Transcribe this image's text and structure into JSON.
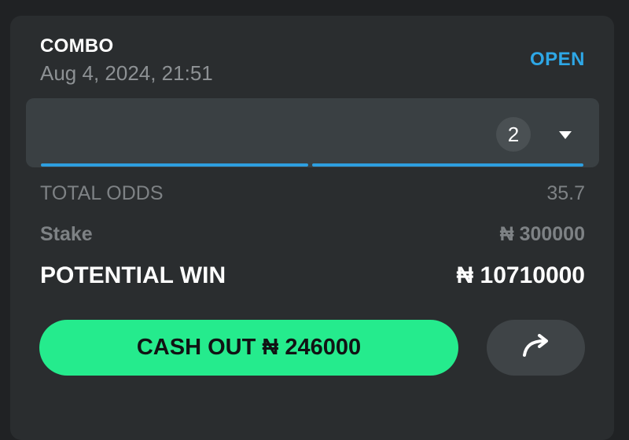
{
  "bet": {
    "type": "COMBO",
    "date": "Aug 4, 2024, 21:51",
    "status": "OPEN"
  },
  "selections": {
    "count": "2",
    "expand_icon": "chevron-down-icon"
  },
  "summary": {
    "odds_label": "TOTAL ODDS",
    "odds_value": "35.7",
    "stake_label": "Stake",
    "stake_value": "₦ 300000",
    "win_label": "POTENTIAL WIN",
    "win_value": "₦ 10710000"
  },
  "actions": {
    "cashout_label": "CASH OUT ₦ 246000",
    "share_icon": "share-arrow-icon"
  },
  "colors": {
    "accent": "#2ea7e6",
    "cashout": "#25eb8d",
    "card": "#2a2d2f",
    "background": "#202224"
  }
}
